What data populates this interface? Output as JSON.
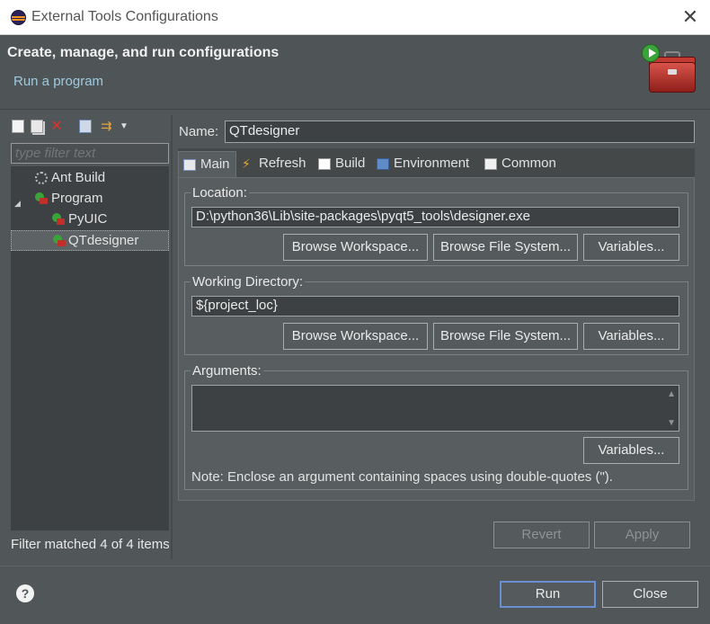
{
  "window": {
    "title": "External Tools Configurations",
    "close_glyph": "✕"
  },
  "header": {
    "title": "Create, manage, and run configurations",
    "subtitle": "Run a program"
  },
  "left": {
    "filter_placeholder": "type filter text",
    "tree": [
      {
        "label": "Ant Build",
        "icon": "ant-build-icon"
      },
      {
        "label": "Program",
        "icon": "program-icon",
        "expanded": true
      },
      {
        "label": "PyUIC",
        "icon": "program-launch-icon"
      },
      {
        "label": "QTdesigner",
        "icon": "program-launch-icon",
        "selected": true
      }
    ],
    "filter_status": "Filter matched 4 of 4 items"
  },
  "right": {
    "name_label": "Name:",
    "name_value": "QTdesigner",
    "tabs": [
      {
        "label": "Main",
        "icon": "main-tab-icon",
        "active": true
      },
      {
        "label": "Refresh",
        "icon": "refresh-icon"
      },
      {
        "label": "Build",
        "icon": "build-icon"
      },
      {
        "label": "Environment",
        "icon": "environment-icon"
      },
      {
        "label": "Common",
        "icon": "common-icon"
      }
    ],
    "location": {
      "title": "Location:",
      "value": "D:\\python36\\Lib\\site-packages\\pyqt5_tools\\designer.exe",
      "browse_workspace": "Browse Workspace...",
      "browse_fs": "Browse File System...",
      "variables": "Variables..."
    },
    "workdir": {
      "title": "Working Directory:",
      "value": "${project_loc}",
      "browse_workspace": "Browse Workspace...",
      "browse_fs": "Browse File System...",
      "variables": "Variables..."
    },
    "arguments": {
      "title": "Arguments:",
      "value": "",
      "variables": "Variables...",
      "note": "Note: Enclose an argument containing spaces using double-quotes (\")."
    },
    "revert": "Revert",
    "apply": "Apply"
  },
  "footer": {
    "help": "?",
    "run": "Run",
    "close": "Close"
  }
}
